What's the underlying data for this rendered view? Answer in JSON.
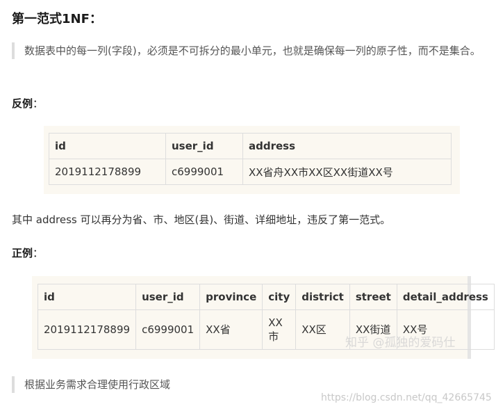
{
  "heading": "第一范式1NF：",
  "definition": "数据表中的每一列(字段)，必须是不可拆分的最小单元，也就是确保每一列的原子性，而不是集合。",
  "counter_example": {
    "label": "反例",
    "colon": "：",
    "headers": [
      "id",
      "user_id",
      "address"
    ],
    "rows": [
      [
        "2019112178899",
        "c6999001",
        "XX省舟XX市XX区XX街道XX号"
      ]
    ]
  },
  "explanation": "其中 address 可以再分为省、市、地区(县)、街道、详细地址，违反了第一范式。",
  "correct_example": {
    "label": "正例",
    "colon": "：",
    "headers": [
      "id",
      "user_id",
      "province",
      "city",
      "district",
      "street",
      "detail_address"
    ],
    "rows": [
      [
        "2019112178899",
        "c6999001",
        "XX省",
        "XX市",
        "XX区",
        "XX街道",
        "XX号"
      ]
    ]
  },
  "note": "根据业务需求合理使用行政区域",
  "watermark": "知乎 @孤独的爱码仕",
  "source_url": "https://blog.csdn.net/qq_42665745"
}
